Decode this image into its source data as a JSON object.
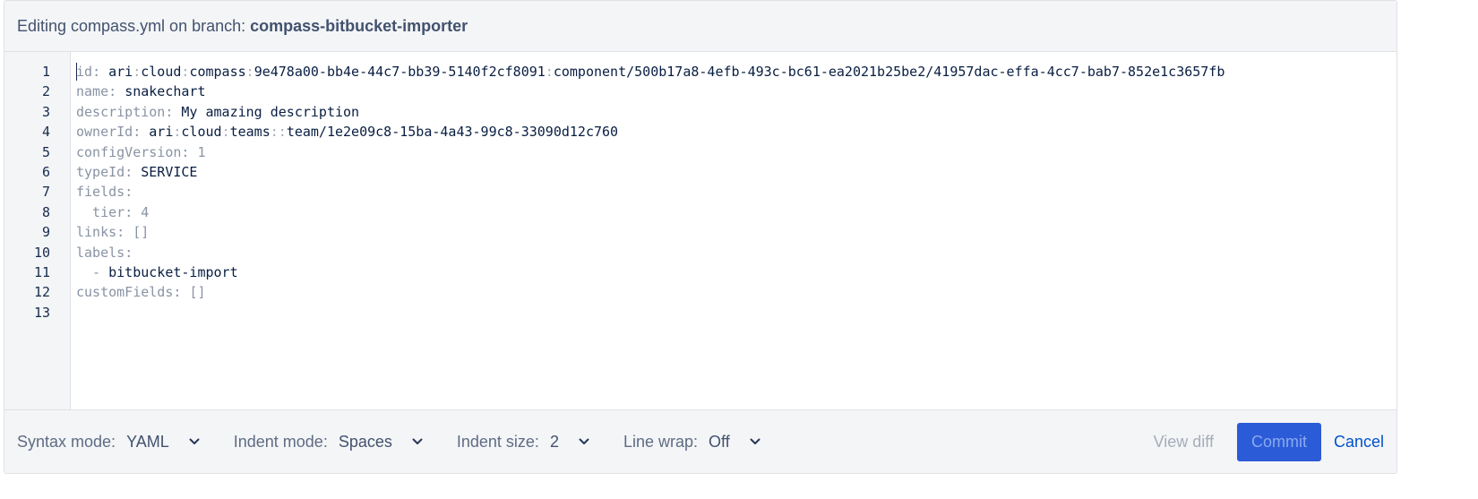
{
  "header": {
    "prefix": "Editing compass.yml on branch:",
    "branch": "compass-bitbucket-importer"
  },
  "editor": {
    "line_numbers": [
      "1",
      "2",
      "3",
      "4",
      "5",
      "6",
      "7",
      "8",
      "9",
      "10",
      "11",
      "12",
      "13"
    ],
    "lines": [
      [
        {
          "t": "id",
          "c": "k"
        },
        {
          "t": ": ",
          "c": "k"
        },
        {
          "t": "ari",
          "c": "v"
        },
        {
          "t": ":",
          "c": "p"
        },
        {
          "t": "cloud",
          "c": "v"
        },
        {
          "t": ":",
          "c": "p"
        },
        {
          "t": "compass",
          "c": "v"
        },
        {
          "t": ":",
          "c": "p"
        },
        {
          "t": "9e478a00-bb4e-44c7-bb39-5140f2cf8091",
          "c": "v"
        },
        {
          "t": ":",
          "c": "p"
        },
        {
          "t": "component/500b17a8-4efb-493c-bc61-ea2021b25be2/41957dac-effa-4cc7-bab7-852e1c3657fb",
          "c": "v"
        }
      ],
      [
        {
          "t": "name",
          "c": "k"
        },
        {
          "t": ": ",
          "c": "k"
        },
        {
          "t": "snakechart",
          "c": "v"
        }
      ],
      [
        {
          "t": "description",
          "c": "k"
        },
        {
          "t": ": ",
          "c": "k"
        },
        {
          "t": "My amazing description",
          "c": "v"
        }
      ],
      [
        {
          "t": "ownerId",
          "c": "k"
        },
        {
          "t": ": ",
          "c": "k"
        },
        {
          "t": "ari",
          "c": "v"
        },
        {
          "t": ":",
          "c": "p"
        },
        {
          "t": "cloud",
          "c": "v"
        },
        {
          "t": ":",
          "c": "p"
        },
        {
          "t": "teams",
          "c": "v"
        },
        {
          "t": "::",
          "c": "p"
        },
        {
          "t": "team/1e2e09c8-15ba-4a43-99c8-33090d12c760",
          "c": "v"
        }
      ],
      [
        {
          "t": "configVersion",
          "c": "k"
        },
        {
          "t": ": ",
          "c": "k"
        },
        {
          "t": "1",
          "c": "k"
        }
      ],
      [
        {
          "t": "typeId",
          "c": "k"
        },
        {
          "t": ": ",
          "c": "k"
        },
        {
          "t": "SERVICE",
          "c": "v"
        }
      ],
      [
        {
          "t": "fields",
          "c": "k"
        },
        {
          "t": ":",
          "c": "k"
        }
      ],
      [
        {
          "t": "  tier",
          "c": "k"
        },
        {
          "t": ": ",
          "c": "k"
        },
        {
          "t": "4",
          "c": "k"
        }
      ],
      [
        {
          "t": "links",
          "c": "k"
        },
        {
          "t": ": ",
          "c": "k"
        },
        {
          "t": "[]",
          "c": "k"
        }
      ],
      [
        {
          "t": "labels",
          "c": "k"
        },
        {
          "t": ":",
          "c": "k"
        }
      ],
      [
        {
          "t": "  - ",
          "c": "k"
        },
        {
          "t": "bitbucket-import",
          "c": "v"
        }
      ],
      [
        {
          "t": "customFields",
          "c": "k"
        },
        {
          "t": ": ",
          "c": "k"
        },
        {
          "t": "[]",
          "c": "k"
        }
      ],
      []
    ]
  },
  "footer": {
    "syntax_label": "Syntax mode:",
    "syntax_value": "YAML",
    "indent_mode_label": "Indent mode:",
    "indent_mode_value": "Spaces",
    "indent_size_label": "Indent size:",
    "indent_size_value": "2",
    "line_wrap_label": "Line wrap:",
    "line_wrap_value": "Off",
    "view_diff": "View diff",
    "commit": "Commit",
    "cancel": "Cancel"
  },
  "icons": {
    "dropdown": "chevron-down-icon"
  }
}
